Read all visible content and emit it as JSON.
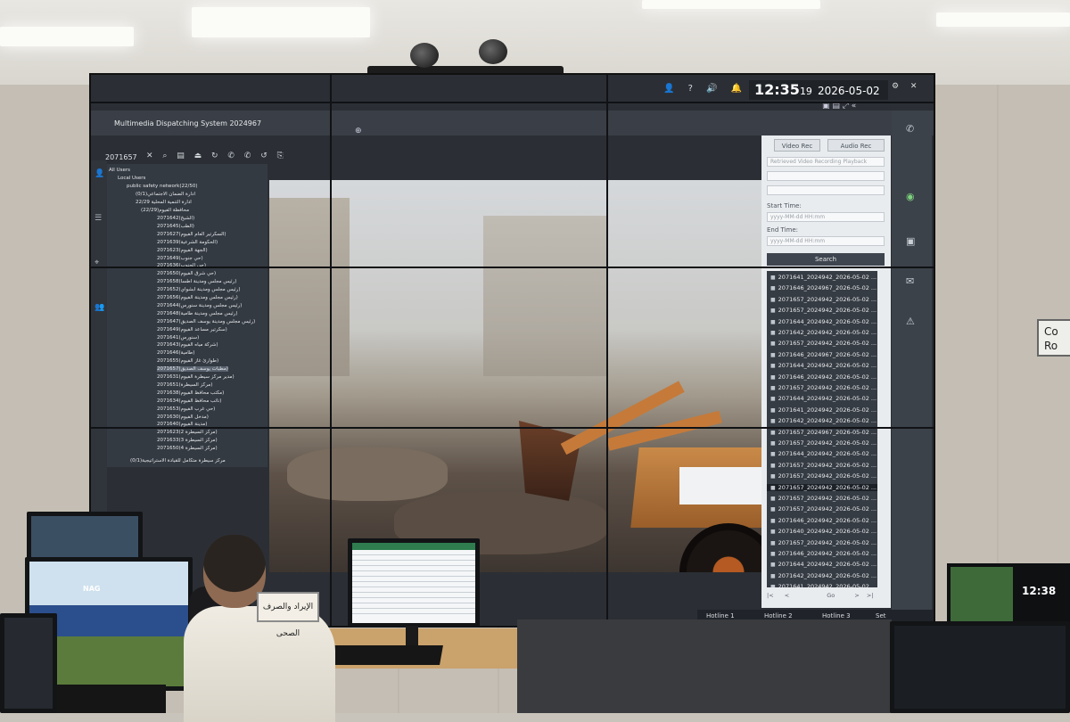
{
  "scene": {
    "signage": {
      "nameplate": "الإيراد والصرف الصحى",
      "wall_sign_line1": "Co",
      "wall_sign_line2": "Ro"
    },
    "corner_tv_time": "12:38",
    "monitor_logo": "NAG"
  },
  "app": {
    "title": "Multimedia Dispatching System 2024967",
    "clock": {
      "time": "12:35",
      "seconds": "19",
      "date": "2026-05-02"
    },
    "window_controls": "⚙ ✕",
    "toolbar": {
      "call_id": "2071657",
      "icons": "✕ ⌕ ▤ ⏏ ↻ ✆ ✆ ↺ ⎘"
    },
    "tree": {
      "root": "All Users",
      "group": "Local Users",
      "subgroup": "public safety network(22/50)",
      "branches": [
        "(0/1)ادارة الضمان الاجتماعي",
        "22/29 ادارة التنمية المحلية",
        "(22/29)محافظة الفيوم"
      ],
      "items": [
        "2071642(الشيخ)",
        "2071645(الطب)",
        "2071627(السكرتير العام الفيوم)",
        "2071639(الحكومة الشرعية)",
        "2071623(الجهة الفيوم)",
        "2071649(حي جنوب)",
        "2071636(حي الجنوب)",
        "2071650(حي شرق الفيوم)",
        "2071658(رئيس مجلس ومدينة اطسا)",
        "2071652(رئيس مجلس ومدينة ابشواي)",
        "2071656(رئيس مجلس ومدينة الفيوم)",
        "2071644(رئيس مجلس ومدينة سنورس)",
        "2071648(رئيس مجلس ومدينة طامية)",
        "2071647(رئيس مجلس ومدينة يوسف الصديق)",
        "2071649(سكرتير مساعد الفيوم)",
        "2071641(سنورس)",
        "2071643(شركة مياه الفيوم)",
        "2071646(طامية)",
        "2071655(طوارئ غاز الفيوم)",
        "2071657(مطبات يوسف الصديق)",
        "2071631(مدير مركز سيطرة الفيوم)",
        "2071651(مركز السيطرة)",
        "2071638(مكتب محافظ الفيوم)",
        "2071634(نائب محافظ الفيوم)",
        "2071653(حي غرب الفيوم)",
        "2071630(مدخل الفيوم)",
        "2071640(مدينة الفيوم)",
        "2071623(مركز السيطرة 2)",
        "2071633(مركز السيطرة 3)",
        "2071650(مركز السيطرة 4)"
      ],
      "footer_branch": "(0/1)مركز سيطرة متكامل للقيادة الاستراتيجية"
    },
    "right_panel": {
      "video_rec": "Video Rec",
      "audio_rec": "Audio Rec",
      "playback_field": "Retrieved Video Recording Playback",
      "field2": "",
      "field3": "",
      "start_label": "Start Time:",
      "start_value": "yyyy-MM-dd HH:mm",
      "end_label": "End Time:",
      "end_value": "yyyy-MM-dd HH:mm",
      "search": "Search",
      "records": [
        "2071641_2024942_2026-05-02 ...",
        "2071646_2024967_2026-05-02 ...",
        "2071657_2024942_2026-05-02 ...",
        "2071657_2024942_2026-05-02 ...",
        "2071644_2024942_2026-05-02 ...",
        "2071642_2024942_2026-05-02 ...",
        "2071657_2024942_2026-05-02 ...",
        "2071646_2024967_2026-05-02 ...",
        "2071644_2024942_2026-05-02 ...",
        "2071646_2024942_2026-05-02 ...",
        "2071657_2024942_2026-05-02 ...",
        "2071644_2024942_2026-05-02 ...",
        "2071641_2024942_2026-05-02 ...",
        "2071642_2024942_2026-05-02 ...",
        "2071657_2024967_2026-05-02 ...",
        "2071657_2024942_2026-05-02 ...",
        "2071644_2024942_2026-05-02 ...",
        "2071657_2024942_2026-05-02 ...",
        "2071657_2024942_2026-05-02 ...",
        "2071657_2024942_2026-05-02 ...",
        "2071657_2024942_2026-05-02 ...",
        "2071657_2024942_2026-05-02 ...",
        "2071646_2024942_2026-05-02 ...",
        "2071640_2024942_2026-05-02 ...",
        "2071657_2024942_2026-05-02 ...",
        "2071646_2024942_2026-05-02 ...",
        "2071644_2024942_2026-05-02 ...",
        "2071642_2024942_2026-05-02 ...",
        "2071641_2024942_2026-05-02 ..."
      ],
      "selected_index": 19,
      "pager": {
        "first": "|<",
        "prev": "<",
        "go": "Go",
        "next": ">",
        "last": ">|"
      }
    },
    "hotlines": [
      "Hotline 1",
      "Hotline 2",
      "Hotline 3",
      "Set"
    ]
  }
}
